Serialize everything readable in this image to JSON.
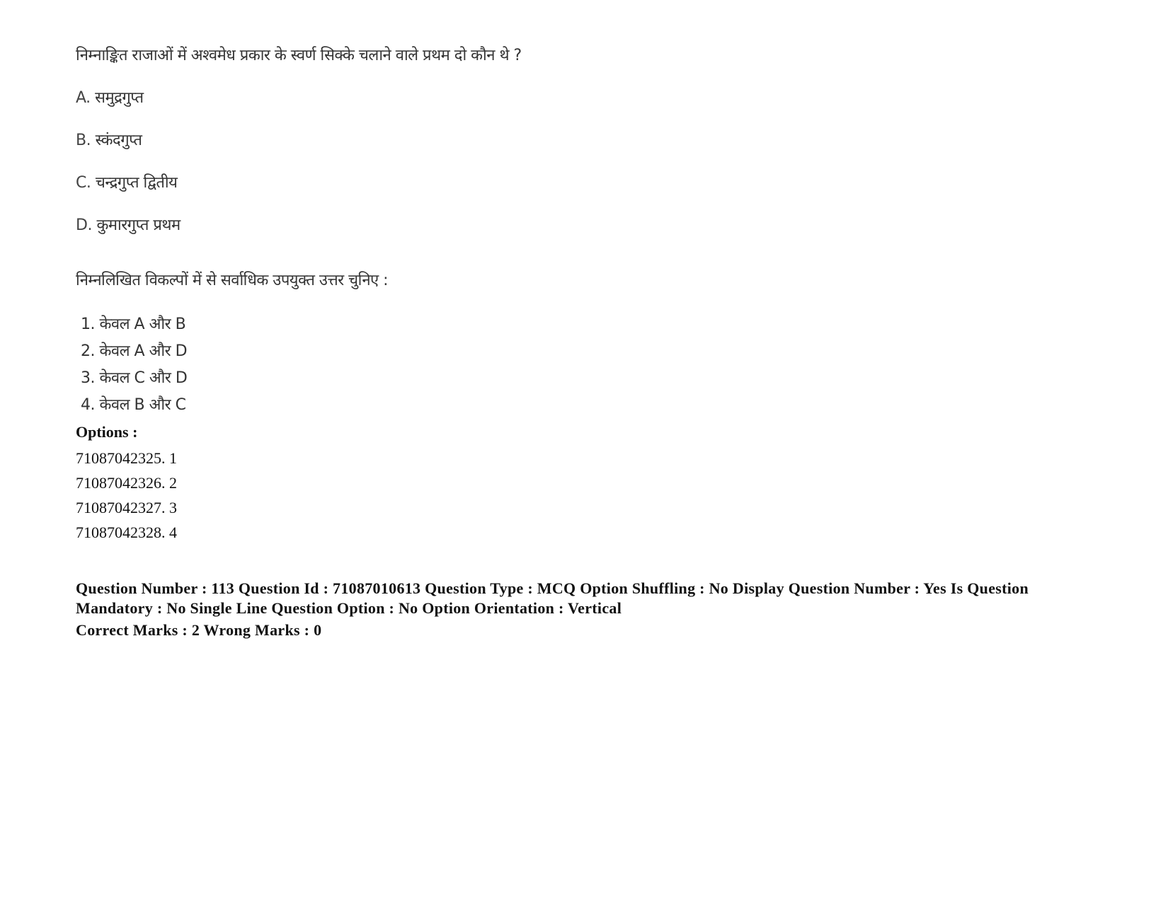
{
  "question": {
    "text": "निम्नाङ्कित राजाओं में अश्वमेध प्रकार के स्वर्ण सिक्के चलाने वाले प्रथम दो कौन थे ?",
    "statements": [
      {
        "label": "A.",
        "text": "समुद्रगुप्त"
      },
      {
        "label": "B.",
        "text": "स्कंदगुप्त"
      },
      {
        "label": "C.",
        "text": "चन्द्रगुप्त द्वितीय"
      },
      {
        "label": "D.",
        "text": "कुमारगुप्त प्रथम"
      }
    ],
    "instruction": "निम्नलिखित विकल्पों में से सर्वाधिक उपयुक्त उत्तर चुनिए :",
    "choices": [
      {
        "num": "1.",
        "text": "केवल A और B"
      },
      {
        "num": "2.",
        "text": "केवल A और D"
      },
      {
        "num": "3.",
        "text": "केवल C और D"
      },
      {
        "num": "4.",
        "text": "केवल B और C"
      }
    ]
  },
  "options": {
    "heading": "Options :",
    "items": [
      {
        "id": "71087042325.",
        "value": "1"
      },
      {
        "id": "71087042326.",
        "value": "2"
      },
      {
        "id": "71087042327.",
        "value": "3"
      },
      {
        "id": "71087042328.",
        "value": "4"
      }
    ]
  },
  "meta": {
    "line": "Question Number : 113 Question Id : 71087010613 Question Type : MCQ Option Shuffling : No Display Question Number : Yes Is Question Mandatory : No Single Line Question Option : No Option Orientation : Vertical",
    "marks": "Correct Marks : 2 Wrong Marks : 0"
  }
}
